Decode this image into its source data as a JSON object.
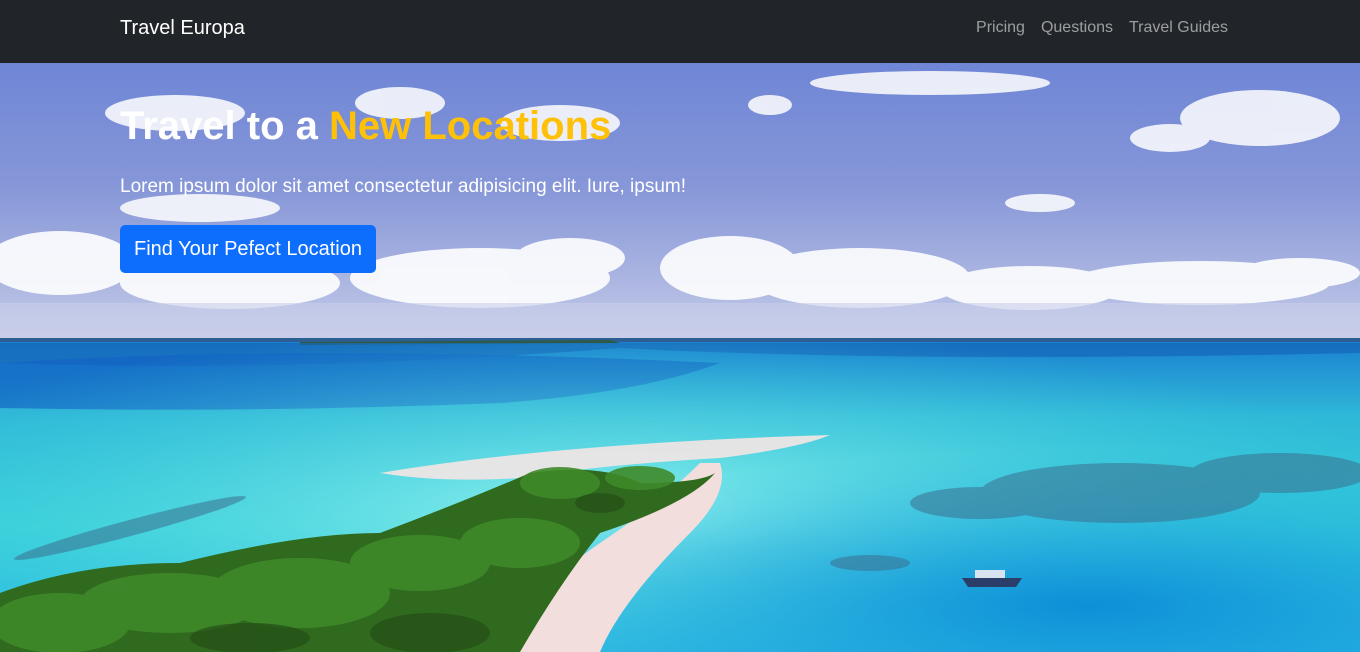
{
  "navbar": {
    "brand": "Travel Europa",
    "links": [
      {
        "label": "Pricing"
      },
      {
        "label": "Questions"
      },
      {
        "label": "Travel Guides"
      }
    ],
    "background": "#212529"
  },
  "hero": {
    "title_prefix": "Travel to a ",
    "title_accent": "New Locations",
    "subtitle": "Lorem ipsum dolor sit amet consectetur adipisicing elit. Iure, ipsum!",
    "cta_label": "Find Your Pefect Location",
    "background_image": "tropical-beach-lagoon-aerial",
    "accent_color": "#ffc107",
    "cta_color": "#0d6efd"
  }
}
